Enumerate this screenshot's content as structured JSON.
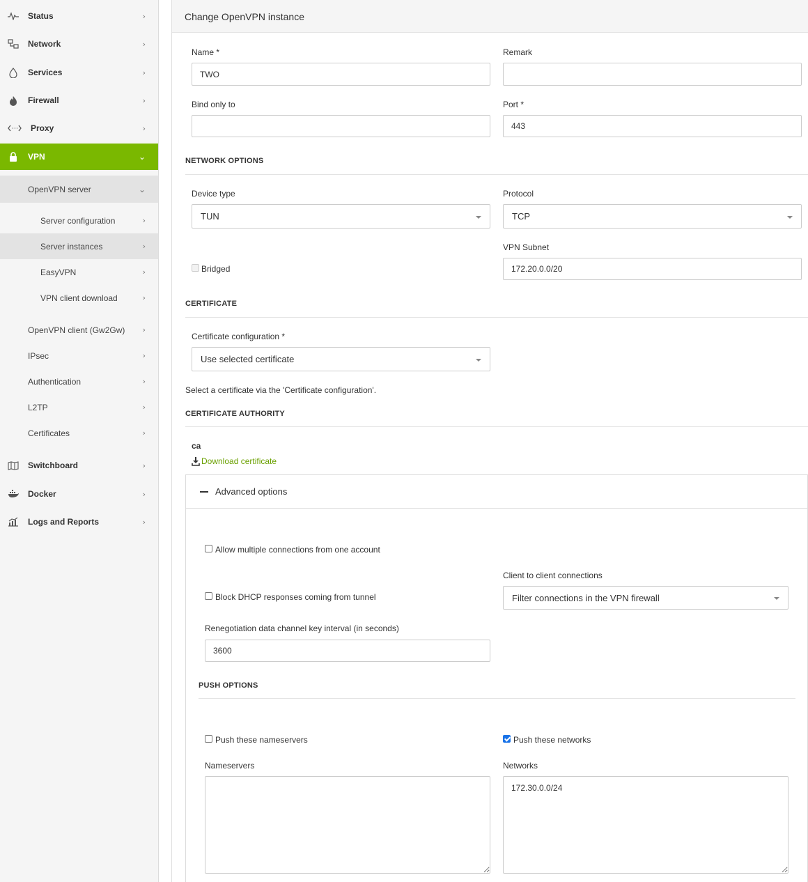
{
  "sidebar": {
    "items": [
      {
        "label": "Status"
      },
      {
        "label": "Network"
      },
      {
        "label": "Services"
      },
      {
        "label": "Firewall"
      },
      {
        "label": "Proxy"
      },
      {
        "label": "VPN"
      },
      {
        "label": "OpenVPN server"
      },
      {
        "label": "Server configuration"
      },
      {
        "label": "Server instances"
      },
      {
        "label": "EasyVPN"
      },
      {
        "label": "VPN client download"
      },
      {
        "label": "OpenVPN client (Gw2Gw)"
      },
      {
        "label": "IPsec"
      },
      {
        "label": "Authentication"
      },
      {
        "label": "L2TP"
      },
      {
        "label": "Certificates"
      },
      {
        "label": "Switchboard"
      },
      {
        "label": "Docker"
      },
      {
        "label": "Logs and Reports"
      }
    ]
  },
  "header": {
    "title": "Change OpenVPN instance"
  },
  "form": {
    "name": {
      "label": "Name *",
      "value": "TWO"
    },
    "remark": {
      "label": "Remark",
      "value": ""
    },
    "bind": {
      "label": "Bind only to",
      "value": ""
    },
    "port": {
      "label": "Port *",
      "value": "443"
    }
  },
  "network": {
    "heading": "NETWORK OPTIONS",
    "device_type": {
      "label": "Device type",
      "value": "TUN"
    },
    "protocol": {
      "label": "Protocol",
      "value": "TCP"
    },
    "vpn_subnet": {
      "label": "VPN Subnet",
      "value": "172.20.0.0/20"
    },
    "bridged": {
      "label": "Bridged",
      "checked": false
    }
  },
  "certificate": {
    "heading": "CERTIFICATE",
    "config": {
      "label": "Certificate configuration *",
      "value": "Use selected certificate"
    },
    "hint": "Select a certificate via the 'Certificate configuration'."
  },
  "ca": {
    "heading": "CERTIFICATE AUTHORITY",
    "name": "ca",
    "download": "Download certificate"
  },
  "advanced": {
    "title": "Advanced options",
    "multi": {
      "label": "Allow multiple connections from one account",
      "checked": false
    },
    "block_dhcp": {
      "label": "Block DHCP responses coming from tunnel",
      "checked": false
    },
    "c2c": {
      "label": "Client to client connections",
      "value": "Filter connections in the VPN firewall"
    },
    "reneg": {
      "label": "Renegotiation data channel key interval (in seconds)",
      "value": "3600"
    },
    "push": {
      "heading": "PUSH OPTIONS",
      "push_ns": {
        "label": "Push these nameservers",
        "checked": false
      },
      "push_nets": {
        "label": "Push these networks",
        "checked": true
      },
      "nameservers": {
        "label": "Nameservers",
        "value": ""
      },
      "networks": {
        "label": "Networks",
        "value": "172.30.0.0/24"
      }
    }
  },
  "colors": {
    "accent": "#7ab800",
    "link": "#6aa000",
    "checkbox": "#1a73e8"
  }
}
